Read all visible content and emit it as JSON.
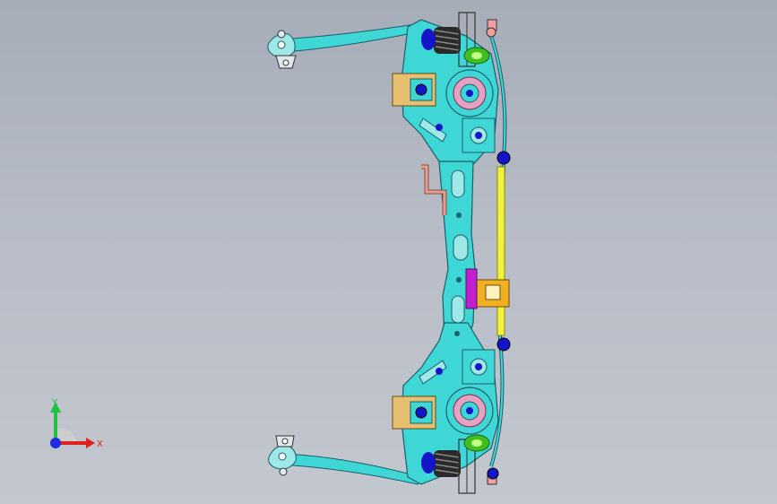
{
  "viewport": {
    "background_top": "#a6acb8",
    "background_bottom": "#c3c7cf"
  },
  "model": {
    "frame_color": "#3fd6d6",
    "frame_edge": "#1a5f6a",
    "stabilizer_bar_color": "#f2f23a",
    "bushing_color": "#1414c8",
    "bracket_color": "#e6c070",
    "mount_color": "#f0b020",
    "actuator_color": "#c020d0",
    "pipe_color": "#e0a090",
    "spring_color": "#2a2a2a",
    "green_part_color": "#40c020"
  },
  "triad": {
    "x_label": "X",
    "y_label": "Y",
    "x_color": "#e02020",
    "y_color": "#20c040",
    "origin_color": "#1e2ee0"
  }
}
